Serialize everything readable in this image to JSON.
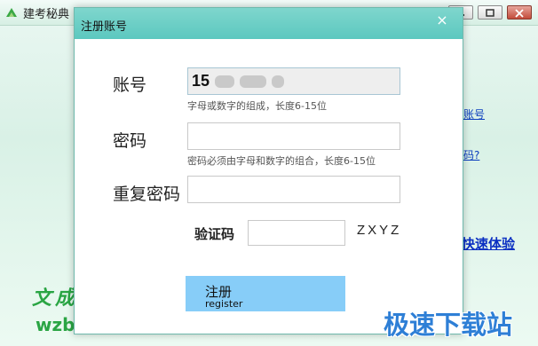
{
  "main_window": {
    "title": "建考秘典",
    "links": {
      "account": "账号",
      "password": "码?",
      "quick": "快速体验"
    },
    "brand_line1": "文成",
    "brand_line2": "wzbssc",
    "watermark": "极速下载站"
  },
  "dialog": {
    "title": "注册账号",
    "close_icon": "×",
    "account": {
      "label": "账号",
      "value": "15",
      "hint": "字母或数字的组成，长度6-15位"
    },
    "password": {
      "label": "密码",
      "value": "",
      "hint": "密码必须由字母和数字的组合，长度6-15位"
    },
    "confirm_password": {
      "label": "重复密码",
      "value": ""
    },
    "captcha": {
      "label": "验证码",
      "value": "",
      "code": "ZXYZ"
    },
    "register_button": {
      "label_zh": "注册",
      "label_en": "register"
    }
  },
  "colors": {
    "dialog_titlebar": "#5cc8bf",
    "register_button": "#87cdf8",
    "link": "#0a3dbd",
    "brand_green": "#2aa544",
    "watermark_blue": "#2e7fd6"
  }
}
